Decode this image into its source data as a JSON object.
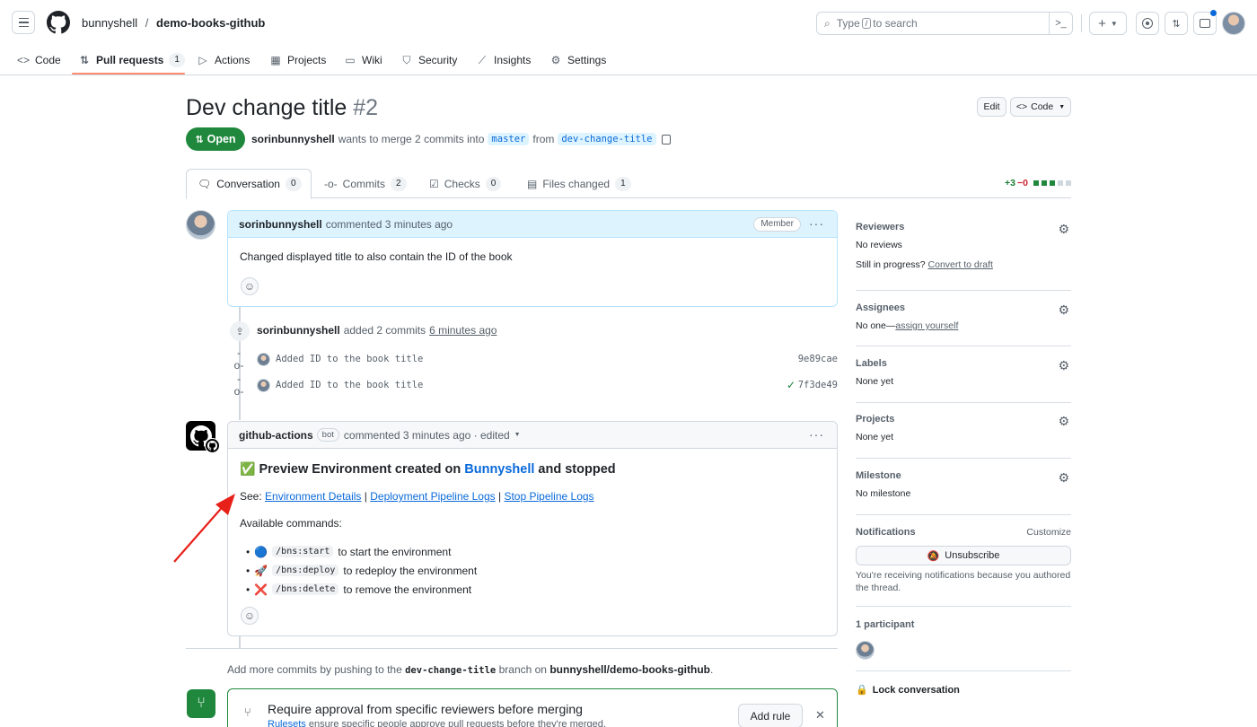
{
  "header": {
    "owner": "bunnyshell",
    "separator": "/",
    "repo": "demo-books-github",
    "search_prefix": "Type",
    "search_key": "/",
    "search_suffix": "to search",
    "terminal_glyph": ">_"
  },
  "repo_nav": {
    "items": [
      {
        "label": "Code"
      },
      {
        "label": "Pull requests",
        "count": "1"
      },
      {
        "label": "Actions"
      },
      {
        "label": "Projects"
      },
      {
        "label": "Wiki"
      },
      {
        "label": "Security"
      },
      {
        "label": "Insights"
      },
      {
        "label": "Settings"
      }
    ]
  },
  "pr": {
    "title": "Dev change title",
    "number": "#2",
    "edit_label": "Edit",
    "code_label": "Code",
    "state": "Open",
    "author": "sorinbunnyshell",
    "merge_text": "wants to merge 2 commits into",
    "base_branch": "master",
    "from_text": "from",
    "head_branch": "dev-change-title"
  },
  "tabs": [
    {
      "label": "Conversation",
      "count": "0"
    },
    {
      "label": "Commits",
      "count": "2"
    },
    {
      "label": "Checks",
      "count": "0"
    },
    {
      "label": "Files changed",
      "count": "1"
    }
  ],
  "diffstat": {
    "additions": "+3",
    "deletions": "−0"
  },
  "comment1": {
    "author": "sorinbunnyshell",
    "meta": "commented 3 minutes ago",
    "role": "Member",
    "body": "Changed displayed title to also contain the ID of the book"
  },
  "commits_event": {
    "author": "sorinbunnyshell",
    "text": "added 2 commits",
    "time": "6 minutes ago",
    "commits": [
      {
        "message": "Added ID to the book title",
        "sha": "9e89cae"
      },
      {
        "message": "Added ID to the book title",
        "sha": "7f3de49"
      }
    ]
  },
  "comment2": {
    "author": "github-actions",
    "bot_label": "bot",
    "meta": "commented 3 minutes ago · edited",
    "heading_emoji": "✅",
    "heading_prefix": "Preview Environment created on",
    "heading_link": "Bunnyshell",
    "heading_suffix": "and stopped",
    "see_label": "See:",
    "links": [
      "Environment Details",
      "Deployment Pipeline Logs",
      "Stop Pipeline Logs"
    ],
    "link_sep": "|",
    "commands_label": "Available commands:",
    "commands": [
      {
        "emoji": "🔵",
        "cmd": "/bns:start",
        "desc": "to start the environment"
      },
      {
        "emoji": "🚀",
        "cmd": "/bns:deploy",
        "desc": "to redeploy the environment"
      },
      {
        "emoji": "❌",
        "cmd": "/bns:delete",
        "desc": "to remove the environment"
      }
    ]
  },
  "bottom": {
    "prefix": "Add more commits by pushing to the",
    "branch": "dev-change-title",
    "middle": "branch on",
    "repo": "bunnyshell/demo-books-github",
    "suffix": "."
  },
  "merge_box": {
    "title": "Require approval from specific reviewers before merging",
    "subtitle_link": "Rulesets",
    "subtitle_text": "ensure specific people approve pull requests before they're merged.",
    "button": "Add rule"
  },
  "sidebar": {
    "reviewers": {
      "title": "Reviewers",
      "value": "No reviews",
      "progress_text": "Still in progress?",
      "progress_link": "Convert to draft"
    },
    "assignees": {
      "title": "Assignees",
      "value": "No one—",
      "link": "assign yourself"
    },
    "labels": {
      "title": "Labels",
      "value": "None yet"
    },
    "projects": {
      "title": "Projects",
      "value": "None yet"
    },
    "milestone": {
      "title": "Milestone",
      "value": "No milestone"
    },
    "notifications": {
      "title": "Notifications",
      "customize": "Customize",
      "button": "Unsubscribe",
      "note": "You're receiving notifications because you authored the thread."
    },
    "participants": {
      "title": "1 participant"
    },
    "lock": "Lock conversation"
  },
  "colors": {
    "accent": "#0969da",
    "open_green": "#1f883d",
    "nav_underline": "#fd8c73",
    "arrow": "#e8201a"
  }
}
